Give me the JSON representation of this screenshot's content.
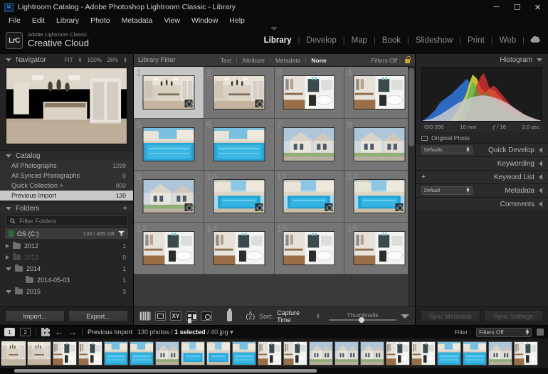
{
  "window": {
    "title": "Lightroom Catalog - Adobe Photoshop Lightroom Classic - Library",
    "app_badge": "Lr",
    "minimize": "─",
    "maximize": "☐",
    "close": "✕"
  },
  "menubar": {
    "items": [
      "File",
      "Edit",
      "Library",
      "Photo",
      "Metadata",
      "View",
      "Window",
      "Help"
    ]
  },
  "identity": {
    "logo": "LrC",
    "line1": "Adobe Lightroom Classic",
    "line2": "Creative Cloud"
  },
  "modules": {
    "items": [
      "Library",
      "Develop",
      "Map",
      "Book",
      "Slideshow",
      "Print",
      "Web"
    ],
    "active": "Library",
    "separator": "|",
    "cloud_icon": "cloud-icon"
  },
  "navigator": {
    "title": "Navigator",
    "zoom_fit": "FIT",
    "zoom_100": "100%",
    "zoom_custom": "26%"
  },
  "catalog": {
    "title": "Catalog",
    "rows": [
      {
        "label": "All Photographs",
        "count": "1299"
      },
      {
        "label": "All Synced Photographs",
        "count": "0"
      },
      {
        "label": "Quick Collection  +",
        "count": "800"
      },
      {
        "label": "Previous Import",
        "count": "130"
      }
    ],
    "selected_index": 3
  },
  "folders": {
    "title": "Folders",
    "add_icon": "add-folder-icon",
    "filter_placeholder": "Filter Folders",
    "search_icon": "search-icon",
    "volume": {
      "name": "OS (C:)",
      "size": "130 / 465 GB",
      "filter_icon": "funnel-icon"
    },
    "rows": [
      {
        "label": "2012",
        "count": "1",
        "state": "collapsed",
        "dim": false,
        "indent": 0
      },
      {
        "label": "2013",
        "count": "0",
        "state": "collapsed",
        "dim": true,
        "indent": 0
      },
      {
        "label": "2014",
        "count": "1",
        "state": "expanded",
        "dim": false,
        "indent": 0
      },
      {
        "label": "2014-05-03",
        "count": "1",
        "state": "leaf",
        "dim": false,
        "indent": 1
      },
      {
        "label": "2015",
        "count": "3",
        "state": "expanded",
        "dim": false,
        "indent": 0
      }
    ]
  },
  "left_buttons": {
    "import": "Import...",
    "export": "Export..."
  },
  "library_filter": {
    "title": "Library Filter",
    "tabs": [
      "Text",
      "Attribute",
      "Metadata",
      "None"
    ],
    "active_tab": "None",
    "filters_off": "Filters Off :",
    "lock_icon": "lock-icon"
  },
  "grid": {
    "cells": [
      {
        "num": "1",
        "selected": true,
        "badge": true,
        "kind": "kitchen"
      },
      {
        "num": "2",
        "selected": false,
        "badge": true,
        "kind": "kitchen"
      },
      {
        "num": "3",
        "selected": false,
        "badge": false,
        "kind": "bath"
      },
      {
        "num": "4",
        "selected": false,
        "badge": false,
        "kind": "bath"
      },
      {
        "num": "5",
        "selected": false,
        "badge": false,
        "kind": "pool"
      },
      {
        "num": "6",
        "selected": false,
        "badge": false,
        "kind": "pool"
      },
      {
        "num": "7",
        "selected": false,
        "badge": false,
        "kind": "house"
      },
      {
        "num": "8",
        "selected": false,
        "badge": false,
        "kind": "house"
      },
      {
        "num": "9",
        "selected": false,
        "badge": true,
        "kind": "house"
      },
      {
        "num": "10",
        "selected": false,
        "badge": true,
        "kind": "poolhouse"
      },
      {
        "num": "11",
        "selected": false,
        "badge": true,
        "kind": "poolhouse"
      },
      {
        "num": "12",
        "selected": false,
        "badge": true,
        "kind": "poolhouse"
      },
      {
        "num": "13",
        "selected": false,
        "badge": false,
        "kind": "bath"
      },
      {
        "num": "14",
        "selected": false,
        "badge": false,
        "kind": "bath"
      },
      {
        "num": "15",
        "selected": false,
        "badge": false,
        "kind": "bath"
      },
      {
        "num": "16",
        "selected": false,
        "badge": false,
        "kind": "bath"
      }
    ]
  },
  "toolbar": {
    "view_grid_icon": "grid-view-icon",
    "view_loupe_icon": "loupe-view-icon",
    "view_compare_icon": "compare-view-icon",
    "view_survey_icon": "survey-view-icon",
    "view_people_icon": "people-view-icon",
    "painter_icon": "spray-can-icon",
    "sort_order_icon": "sort-az-icon",
    "sort_label": "Sort:",
    "sort_value": "Capture Time",
    "thumbnails_label": "Thumbnails",
    "chevron_icon": "chevron-down-icon"
  },
  "histogram": {
    "title": "Histogram",
    "iso": "ISO 200",
    "focal": "10 mm",
    "aperture": "ƒ / 16",
    "shutter": "2.0 sec",
    "original_photo": "Original Photo"
  },
  "right_sections": [
    {
      "label": "Quick Develop",
      "preset": "Defaults",
      "has_preset": true,
      "has_plus": false
    },
    {
      "label": "Keywording",
      "preset": "",
      "has_preset": false,
      "has_plus": false
    },
    {
      "label": "Keyword List",
      "preset": "",
      "has_preset": false,
      "has_plus": true
    },
    {
      "label": "Metadata",
      "preset": "Default",
      "has_preset": true,
      "has_plus": false
    },
    {
      "label": "Comments",
      "preset": "",
      "has_preset": false,
      "has_plus": false
    }
  ],
  "right_buttons": {
    "sync_metadata": "Sync Metadata",
    "sync_settings": "Sync Settings"
  },
  "filmstrip_bar": {
    "screen1": "1",
    "screen2": "2",
    "grid_icon": "filmstrip-grid-icon",
    "back_icon": "←",
    "forward_icon": "→",
    "source": "Previous Import",
    "count_photos": "130 photos /",
    "count_selected": "1 selected",
    "count_file": "/ 40.jpg",
    "count_caret": "▾",
    "filter_label": "Filter :",
    "filter_value": "Filters Off",
    "filter_badge_icon": "filter-badge-icon"
  },
  "filmstrip": {
    "thumbs": [
      {
        "kind": "kitchen",
        "selected": true
      },
      {
        "kind": "kitchen",
        "selected": false
      },
      {
        "kind": "bath",
        "selected": false
      },
      {
        "kind": "bath",
        "selected": false
      },
      {
        "kind": "pool",
        "selected": false
      },
      {
        "kind": "pool",
        "selected": false
      },
      {
        "kind": "house",
        "selected": false
      },
      {
        "kind": "poolhouse",
        "selected": false
      },
      {
        "kind": "poolhouse",
        "selected": false
      },
      {
        "kind": "pool",
        "selected": false
      },
      {
        "kind": "bath",
        "selected": false
      },
      {
        "kind": "bath",
        "selected": false
      },
      {
        "kind": "house",
        "selected": false
      },
      {
        "kind": "house",
        "selected": false
      },
      {
        "kind": "house",
        "selected": false
      },
      {
        "kind": "bath",
        "selected": false
      },
      {
        "kind": "bath",
        "selected": false
      },
      {
        "kind": "pool",
        "selected": false
      },
      {
        "kind": "pool",
        "selected": false
      },
      {
        "kind": "house",
        "selected": false
      },
      {
        "kind": "bath",
        "selected": false
      }
    ]
  },
  "colors": {
    "panel_bg": "#252525",
    "grid_bg": "#757575",
    "selected_cell": "#c6c6c6",
    "accent_text": "#f2f2f2",
    "lock_yellow": "#c9a227"
  }
}
